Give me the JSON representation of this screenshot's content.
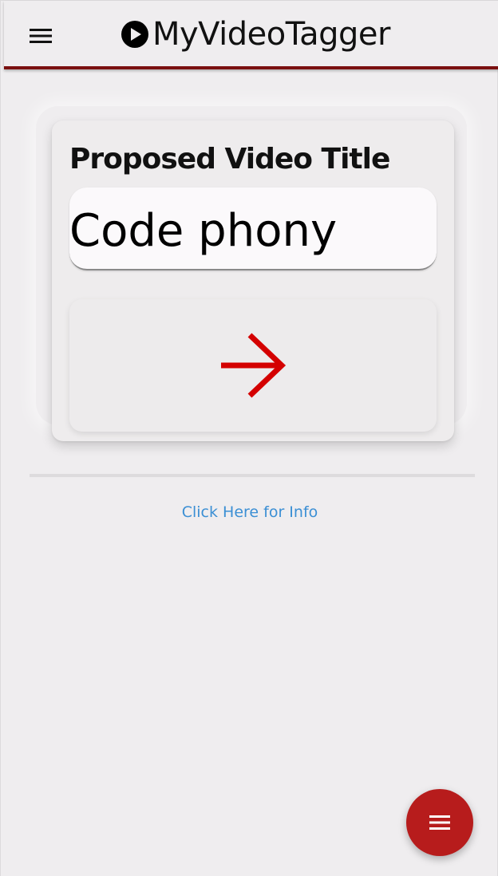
{
  "header": {
    "brand_name": "MyVideoTagger",
    "menu_icon": "hamburger-menu-icon",
    "brand_icon": "play-circle-icon",
    "accent_color": "#7a1010"
  },
  "card": {
    "title": "Proposed Video Title",
    "title_value": "Code phony",
    "submit_icon": "arrow-right-icon",
    "submit_icon_color": "#d40000"
  },
  "info_link": {
    "label": "Click Here for Info",
    "color": "#3b8fd4"
  },
  "fab": {
    "icon": "menu-lines-icon",
    "color": "#b71c1c"
  }
}
